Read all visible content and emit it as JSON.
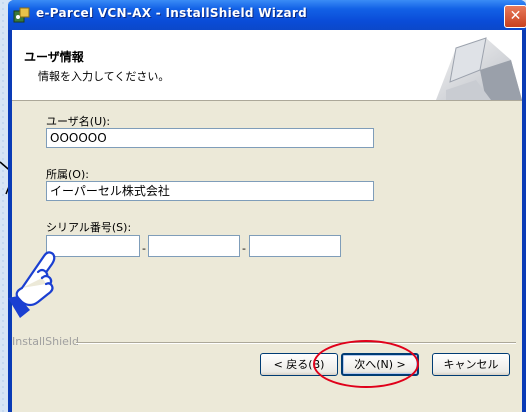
{
  "window": {
    "title": "e-Parcel VCN-AX - InstallShield Wizard",
    "close_symbol": "✕"
  },
  "header": {
    "title": "ユーザ情報",
    "subtitle": "情報を入力してください。"
  },
  "form": {
    "username_label": "ユーザ名(U):",
    "username_value": "OOOOOO",
    "org_label": "所属(O):",
    "org_value": "イーパーセル株式会社",
    "serial_label": "シリアル番号(S):",
    "serial_part1": "",
    "serial_part2": "",
    "serial_part3": "",
    "dash": "-"
  },
  "footer": {
    "brand": "InstallShield"
  },
  "buttons": {
    "back": "< 戻る(B)",
    "next": "次へ(N) >",
    "cancel": "キャンセル"
  },
  "colors": {
    "annotation_ring": "#e0001a",
    "annotation_hand": "#1a3fd1"
  }
}
